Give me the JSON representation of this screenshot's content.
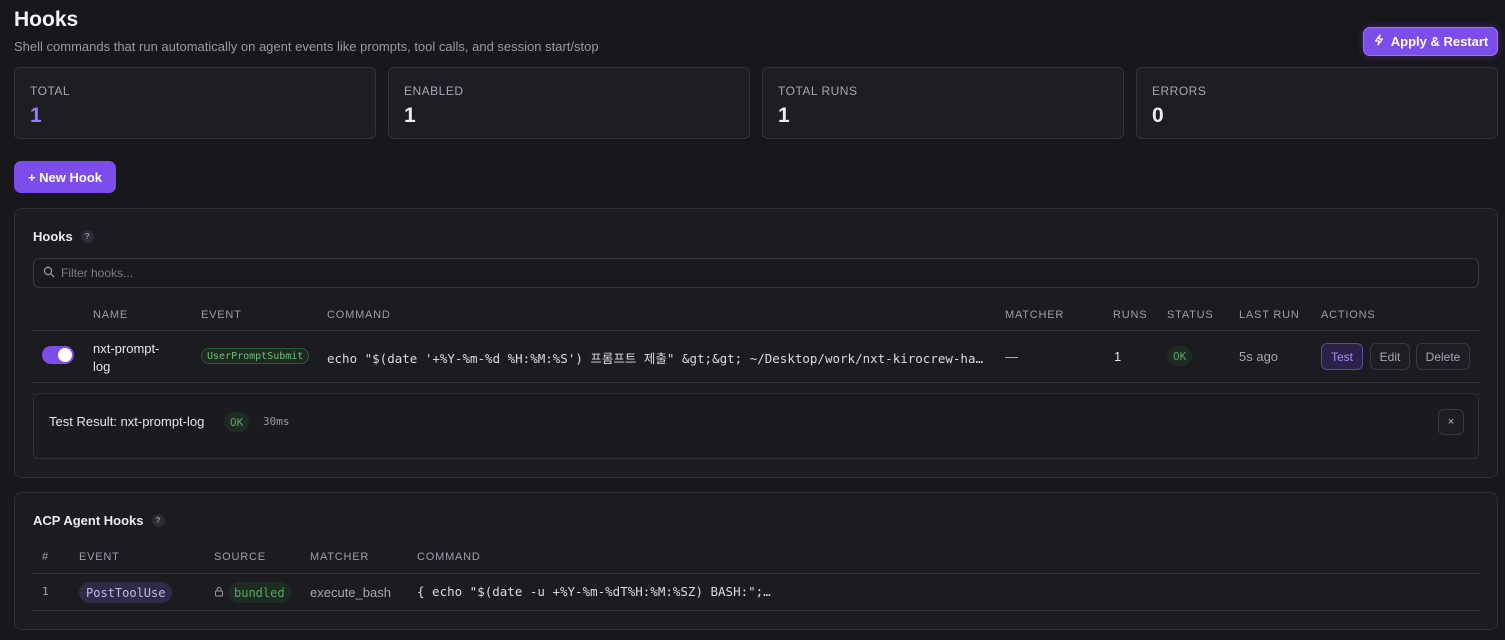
{
  "page": {
    "title": "Hooks",
    "subtitle": "Shell commands that run automatically on agent events like prompts, tool calls, and session start/stop",
    "apply_label": "Apply & Restart",
    "new_hook_label": "+ New Hook"
  },
  "stats": [
    {
      "label": "TOTAL",
      "value": "1"
    },
    {
      "label": "ENABLED",
      "value": "1"
    },
    {
      "label": "TOTAL RUNS",
      "value": "1"
    },
    {
      "label": "ERRORS",
      "value": "0"
    }
  ],
  "hooks": {
    "title": "Hooks",
    "help": "?",
    "filter_placeholder": "Filter hooks...",
    "columns": {
      "name": "NAME",
      "event": "EVENT",
      "command": "COMMAND",
      "matcher": "MATCHER",
      "runs": "RUNS",
      "status": "STATUS",
      "last_run": "LAST RUN",
      "actions": "ACTIONS"
    },
    "rows": [
      {
        "enabled": true,
        "name_line1": "nxt-prompt-",
        "name_line2": "log",
        "event": "UserPromptSubmit",
        "command": "echo \"$(date '+%Y-%m-%d %H:%M:%S') 프롬프트 제출\" &gt;&gt; ~/Desktop/work/nxt-kirocrew-harness/.kiro/hooks.log",
        "matcher": "—",
        "runs": "1",
        "status": "OK",
        "last_run": "5s ago",
        "test_label": "Test",
        "edit_label": "Edit",
        "delete_label": "Delete"
      }
    ],
    "test_result": {
      "label": "Test Result: nxt-prompt-log",
      "status": "OK",
      "duration": "30ms",
      "close": "×"
    }
  },
  "acp": {
    "title": "ACP Agent Hooks",
    "help": "?",
    "columns": {
      "num": "#",
      "event": "EVENT",
      "source": "SOURCE",
      "matcher": "MATCHER",
      "command": "COMMAND"
    },
    "rows": [
      {
        "num": "1",
        "event": "PostToolUse",
        "source": "bundled",
        "matcher": "execute_bash",
        "command": "{ echo \"$(date -u +%Y-%m-%dT%H:%M:%SZ) BASH:\";…"
      }
    ]
  },
  "colors": {
    "accent": "#7c4dea",
    "ok": "#5aa568",
    "background": "#18171c"
  }
}
